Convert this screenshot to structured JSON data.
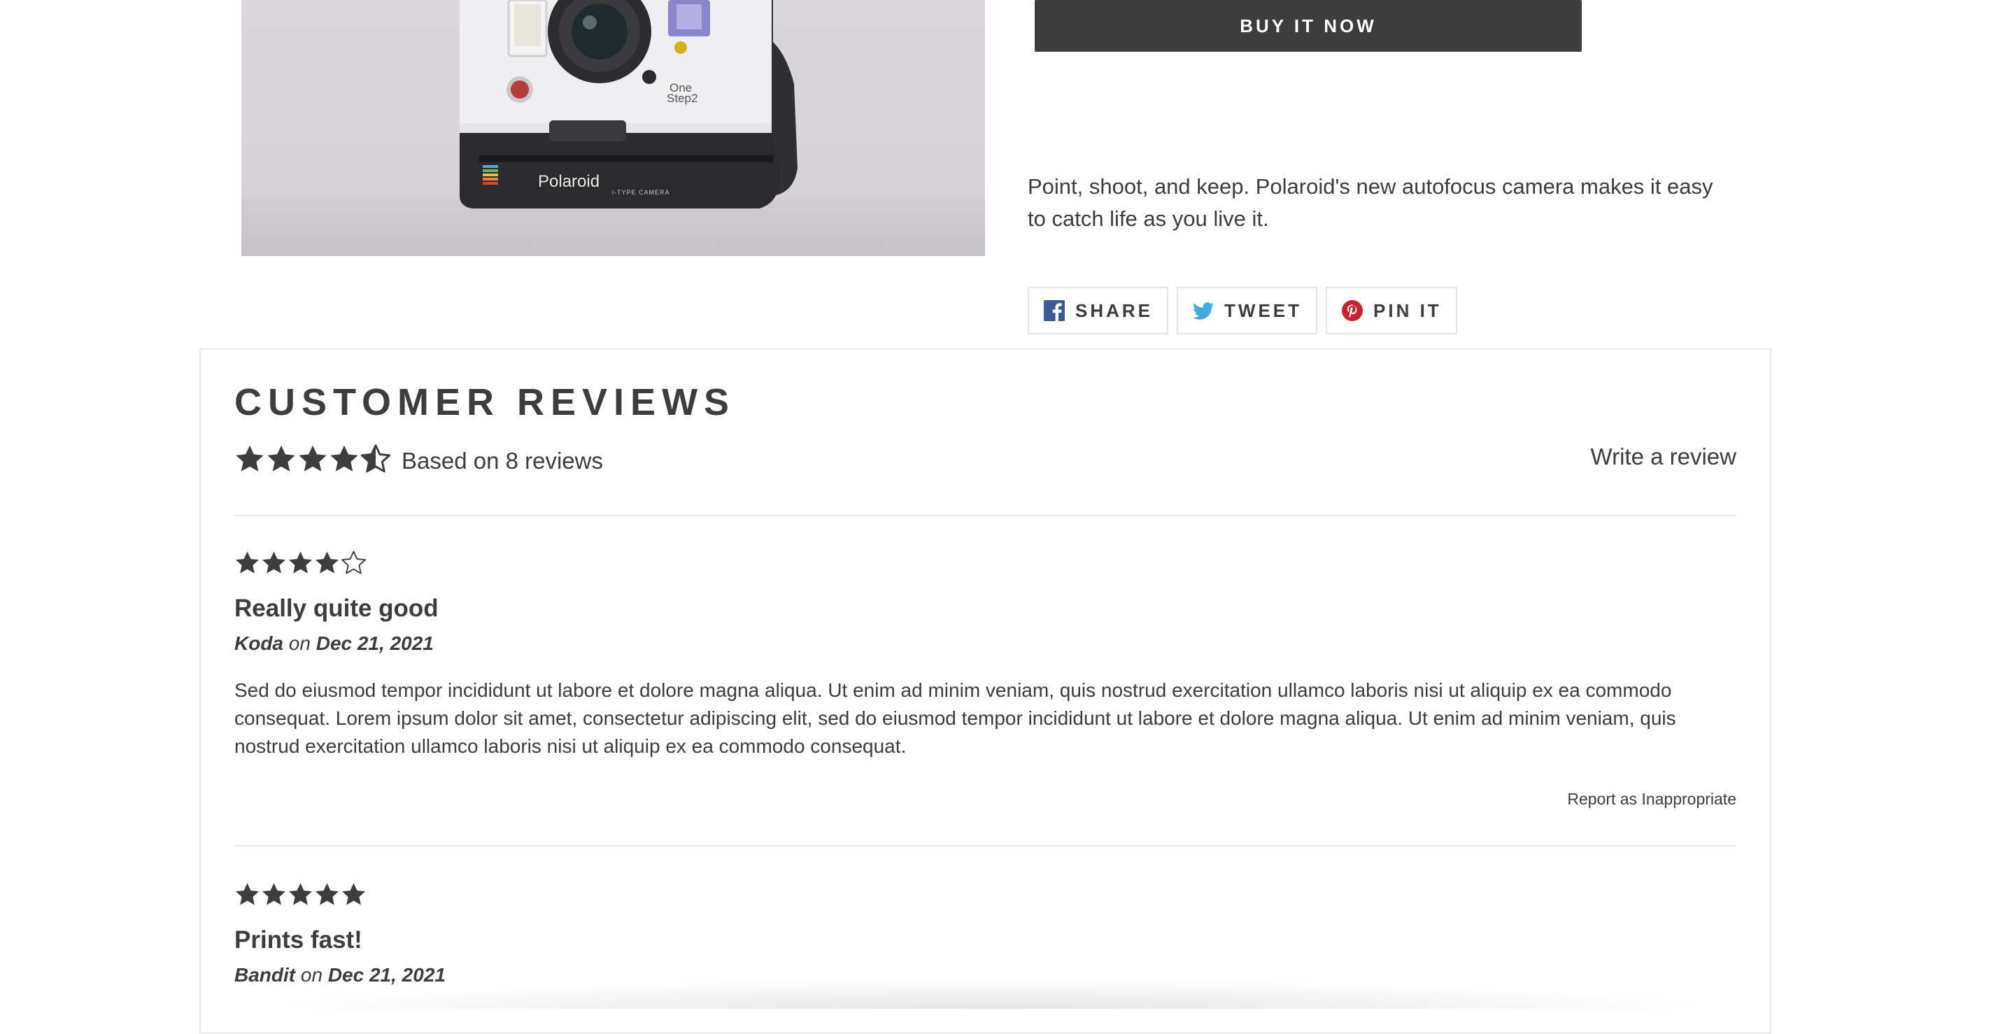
{
  "product": {
    "buy_now_label": "BUY IT NOW",
    "description": "Point, shoot, and keep. Polaroid's new autofocus camera makes it easy to catch life as you live it.",
    "camera_brand": "Polaroid",
    "camera_model_line1": "One",
    "camera_model_line2": "Step2",
    "camera_type": "i-TYPE CAMERA"
  },
  "share": {
    "share_label": "SHARE",
    "tweet_label": "TWEET",
    "pin_label": "PIN IT",
    "facebook_color": "#3b5998",
    "twitter_color": "#3fa9e0",
    "pinterest_color": "#c8232c"
  },
  "reviews": {
    "title": "CUSTOMER REVIEWS",
    "average_rating": 4.5,
    "based_on": "Based on 8 reviews",
    "write_review": "Write a review",
    "items": [
      {
        "rating": 4,
        "title": "Really quite good",
        "author": "Koda",
        "on": "on",
        "date": "Dec 21, 2021",
        "body": "Sed do eiusmod tempor incididunt ut labore et dolore magna aliqua. Ut enim ad minim veniam, quis nostrud exercitation ullamco laboris nisi ut aliquip ex ea commodo consequat. Lorem ipsum dolor sit amet, consectetur adipiscing elit, sed do eiusmod tempor incididunt ut labore et dolore magna aliqua. Ut enim ad minim veniam, quis nostrud exercitation ullamco laboris nisi ut aliquip ex ea commodo consequat.",
        "report": "Report as Inappropriate"
      },
      {
        "rating": 5,
        "title": "Prints fast!",
        "author": "Bandit",
        "on": "on",
        "date": "Dec 21, 2021"
      }
    ]
  },
  "colors": {
    "text": "#3d3d3d",
    "button_bg": "#3d3d3d",
    "border": "#e8e8e8"
  }
}
